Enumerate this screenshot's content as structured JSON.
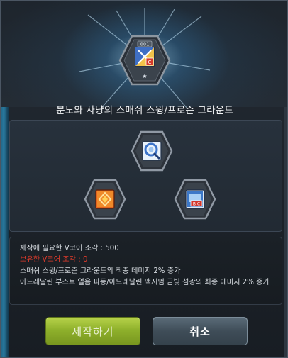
{
  "dialog": {
    "title": "분노와 사냥의 스매쉬 스윙/프로즌 그라운드",
    "result_skill": {
      "icon": "mixed-skill-icon",
      "number_tag": "001",
      "star": "★"
    },
    "ingredients": [
      {
        "icon": "swing-skill-icon",
        "position": "top"
      },
      {
        "icon": "fire-skill-icon",
        "position": "bottom-left"
      },
      {
        "icon": "frozen-skill-icon",
        "position": "bottom-right",
        "badge": "B C"
      }
    ]
  },
  "info": {
    "required_fragments": "제작에 필요한 V코어 조각 : 500",
    "owned_fragments": "보유한 V코어 조각 : 0",
    "effect_1": "스매쉬 스윙/프로즌 그라운드의 최종 데미지 2% 증가",
    "effect_2": "아드레날린 부스트 얼음 파동/아드레날린 맥시멈 금빛 섬광의 최종 데미지 2% 증가"
  },
  "buttons": {
    "make_label": "제작하기",
    "cancel_label": "취소"
  },
  "colors": {
    "owned_warning": "#e23b2b",
    "make_button": "#8fb12c",
    "cancel_button": "#3f4d58"
  }
}
